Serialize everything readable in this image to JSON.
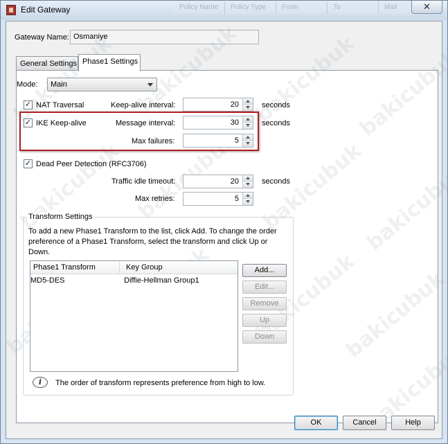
{
  "window": {
    "title": "Edit Gateway",
    "close_glyph": "✕",
    "background_columns": [
      "Policy Name",
      "Policy Type",
      "From",
      "To",
      "Mail"
    ]
  },
  "gateway_name": {
    "label": "Gateway Name:",
    "value": "Osmaniye"
  },
  "tabs": [
    {
      "label": "General Settings",
      "active": false
    },
    {
      "label": "Phase1 Settings",
      "active": true
    }
  ],
  "phase1": {
    "mode": {
      "label": "Mode:",
      "value": "Main"
    },
    "nat_traversal": {
      "label": "NAT Traversal",
      "checked": true,
      "interval_label": "Keep-alive interval:",
      "interval_value": "20",
      "unit": "seconds"
    },
    "ike_keepalive": {
      "label": "IKE Keep-alive",
      "checked": true,
      "interval_label": "Message interval:",
      "interval_value": "30",
      "unit": "seconds",
      "failures_label": "Max failures:",
      "failures_value": "5"
    },
    "dpd": {
      "label": "Dead Peer Detection (RFC3706)",
      "checked": true,
      "timeout_label": "Traffic idle timeout:",
      "timeout_value": "20",
      "unit": "seconds",
      "retries_label": "Max retries:",
      "retries_value": "5"
    }
  },
  "transform": {
    "group_title": "Transform Settings",
    "description": "To add a new Phase1 Transform to the list, click Add. To change the order preference of a Phase1 Transform, select the transform and click Up or Down.",
    "columns": [
      "Phase1 Transform",
      "Key Group"
    ],
    "rows": [
      {
        "transform": "MD5-DES",
        "key_group": "Diffie-Hellman Group1"
      }
    ],
    "buttons": {
      "add": "Add...",
      "edit": "Edit...",
      "remove": "Remove",
      "up": "Up",
      "down": "Down"
    },
    "note": "The order of transform represents preference from high to low.",
    "info_glyph": "i"
  },
  "footer": {
    "ok": "OK",
    "cancel": "Cancel",
    "help": "Help"
  },
  "watermark_text": "bakicubuk",
  "colors": {
    "highlight_border": "#b31c1f",
    "dialog_background": "#f0f0f0"
  }
}
